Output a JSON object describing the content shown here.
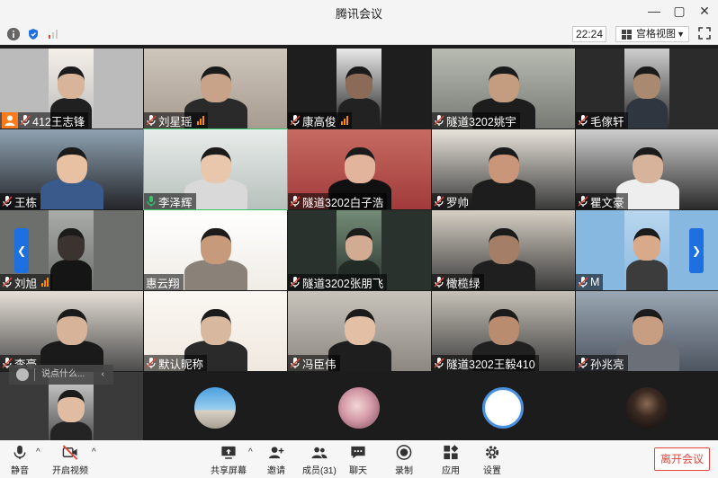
{
  "window": {
    "title": "腾讯会议",
    "controls": [
      "—",
      "▢",
      "✕"
    ]
  },
  "infobar": {
    "time": "22:24",
    "view_mode": "宫格视图"
  },
  "participants": [
    {
      "name": "412王志锋",
      "mic": true,
      "signal": false,
      "host": true,
      "type": "video",
      "bg": "#bbbbbb",
      "fg": "#f4efe9",
      "face": "#d8b59a",
      "shirt": "#202020"
    },
    {
      "name": "刘星瑶",
      "mic": true,
      "signal": true,
      "type": "video",
      "bg": "#a69b8f",
      "fg": "#cfc6bb",
      "face": "#c9a389",
      "shirt": "#2a2a2a"
    },
    {
      "name": "康高俊",
      "mic": true,
      "signal": true,
      "type": "video",
      "bg": "#1e1e1e",
      "fg": "#e9e9e9",
      "face": "#8c6a58",
      "shirt": "#222222"
    },
    {
      "name": "隧道3202姚宇",
      "mic": true,
      "signal": false,
      "type": "video",
      "bg": "#777a74",
      "fg": "#b9bcb3",
      "face": "#c49d80",
      "shirt": "#1d1d1d"
    },
    {
      "name": "毛傢轩",
      "mic": true,
      "signal": false,
      "type": "video",
      "bg": "#2b2b2b",
      "fg": "#cfcfcf",
      "face": "#a9896f",
      "shirt": "#2f3640"
    },
    {
      "name": "王栋",
      "mic": true,
      "signal": false,
      "type": "video",
      "bg": "#24262a",
      "fg": "#8fa2b1",
      "face": "#e8c1a3",
      "shirt": "#3a5a8c"
    },
    {
      "name": "李泽辉",
      "mic": true,
      "signal": false,
      "speaking": true,
      "type": "video",
      "bg": "#b7c0bc",
      "fg": "#e8ecea",
      "face": "#e9c7ad",
      "shirt": "#d9d9d9"
    },
    {
      "name": "隧道3202白子浩",
      "mic": true,
      "signal": false,
      "type": "video",
      "bg": "#a13b3b",
      "fg": "#c66b62",
      "face": "#e2b49b",
      "shirt": "#111111"
    },
    {
      "name": "罗帅",
      "mic": true,
      "signal": false,
      "type": "video",
      "bg": "#3a3a3a",
      "fg": "#e8e3da",
      "face": "#c9967a",
      "shirt": "#1d1d1d"
    },
    {
      "name": "瞿文豪",
      "mic": true,
      "signal": false,
      "type": "video",
      "bg": "#2a2a2a",
      "fg": "#cfcfcf",
      "face": "#d7b39c",
      "shirt": "#eeeeee"
    },
    {
      "name": "刘旭",
      "mic": true,
      "signal": true,
      "type": "video",
      "bg": "#6d6f6c",
      "fg": "#a9aca8",
      "face": "#3a3330",
      "shirt": "#151515"
    },
    {
      "name": "惠云翔",
      "mic": false,
      "signal": false,
      "type": "video",
      "bg": "#f0ece6",
      "fg": "#ffffff",
      "face": "#c79a7c",
      "shirt": "#8a8278"
    },
    {
      "name": "隧道3202张朋飞",
      "mic": true,
      "signal": false,
      "type": "video",
      "bg": "#29322d",
      "fg": "#748c78",
      "face": "#d2ac92",
      "shirt": "#232b26"
    },
    {
      "name": "橄榄绿",
      "mic": true,
      "signal": false,
      "type": "video",
      "bg": "#3b3b3b",
      "fg": "#d6cfc4",
      "face": "#a47e66",
      "shirt": "#1f1f1f"
    },
    {
      "name": "M",
      "mic": true,
      "signal": false,
      "type": "video",
      "bg": "#87b8e0",
      "fg": "#b9d6ee",
      "face": "#d8aa8a",
      "shirt": "#3c3c3c"
    },
    {
      "name": "李豪",
      "mic": true,
      "signal": false,
      "type": "video",
      "bg": "#4c4c4c",
      "fg": "#e5dfd6",
      "face": "#d7b39a",
      "shirt": "#1a1a1a"
    },
    {
      "name": "默认昵称",
      "mic": true,
      "signal": false,
      "type": "video",
      "bg": "#efe8e0",
      "fg": "#fbf7f2",
      "face": "#d9b8a0",
      "shirt": "#2a2a2a"
    },
    {
      "name": "冯臣伟",
      "mic": true,
      "signal": false,
      "type": "video",
      "bg": "#8c8780",
      "fg": "#c8c3bb",
      "face": "#e2bfa5",
      "shirt": "#1e1e1e"
    },
    {
      "name": "隧道3202王毅410",
      "mic": true,
      "signal": false,
      "type": "video",
      "bg": "#3e3e3e",
      "fg": "#c7c2b8",
      "face": "#b98c70",
      "shirt": "#202020"
    },
    {
      "name": "孙兆亮",
      "mic": true,
      "signal": false,
      "type": "video",
      "bg": "#4d5560",
      "fg": "#9aa6b3",
      "face": "#c79e82",
      "shirt": "#6b6f78"
    },
    {
      "name": "",
      "mic": false,
      "signal": false,
      "type": "video",
      "bg": "#3a3a3a",
      "fg": "#d8d8d8",
      "face": "#e0bca2",
      "shirt": "#242424"
    },
    {
      "name": "",
      "mic": false,
      "signal": false,
      "type": "avatar",
      "avatar": "landscape",
      "bg": "#1c1c1c"
    },
    {
      "name": "",
      "mic": false,
      "signal": false,
      "type": "avatar",
      "avatar": "pink-hair",
      "bg": "#1c1c1c"
    },
    {
      "name": "",
      "mic": false,
      "signal": false,
      "type": "avatar",
      "avatar": "cartoon",
      "bg": "#1c1c1c"
    },
    {
      "name": "",
      "mic": false,
      "signal": false,
      "type": "avatar",
      "avatar": "portrait",
      "bg": "#1c1c1c"
    }
  ],
  "chat": {
    "placeholder": "说点什么..."
  },
  "toolbar": {
    "mute": "静音",
    "video": "开启视频",
    "share": "共享屏幕",
    "invite": "邀请",
    "members": "成员(31)",
    "chat": "聊天",
    "record": "录制",
    "apps": "应用",
    "settings": "设置",
    "leave": "离开会议"
  },
  "colors": {
    "accent": "#1e6fe0",
    "leave": "#e0473c",
    "signal": "#ff8a00",
    "host": "#ff7a1a"
  }
}
